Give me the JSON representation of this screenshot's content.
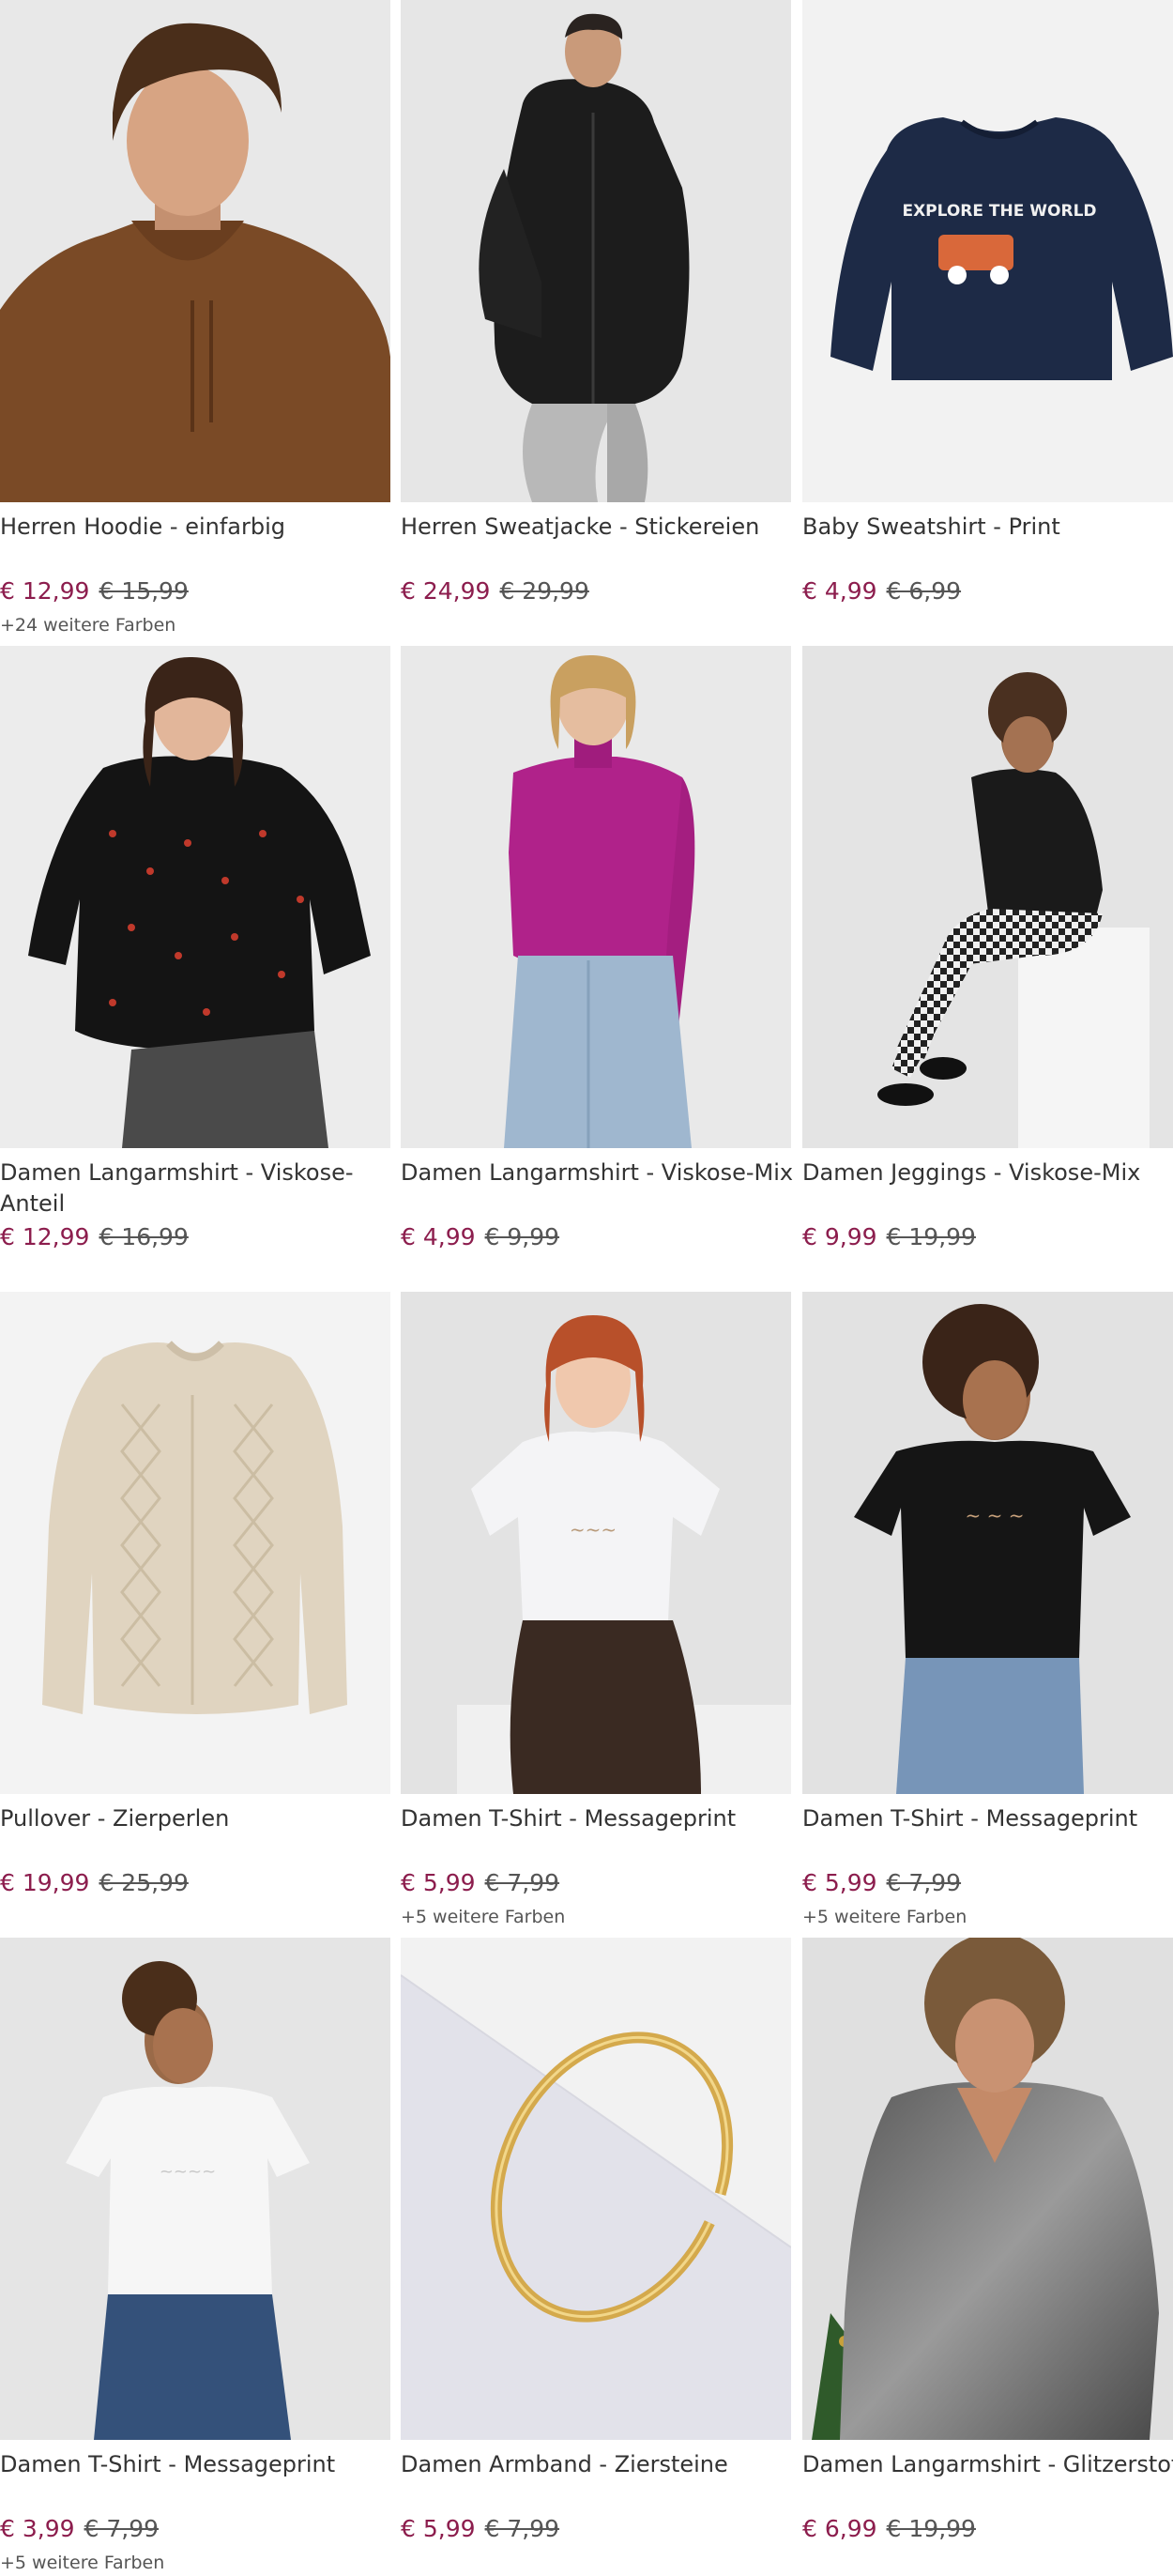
{
  "products": [
    {
      "title": "Herren Hoodie - einfarbig",
      "price": "€ 12,99",
      "old_price": "€ 15,99",
      "colors": "+24 weitere Farben"
    },
    {
      "title": "Herren Sweatjacke - Stickereien",
      "price": "€ 24,99",
      "old_price": "€ 29,99",
      "colors": ""
    },
    {
      "title": "Baby Sweatshirt - Print",
      "price": "€ 4,99",
      "old_price": "€ 6,99",
      "colors": "",
      "graphic_text": "EXPLORE THE WORLD"
    },
    {
      "title": "Damen Langarmshirt - Viskose-Anteil",
      "price": "€ 12,99",
      "old_price": "€ 16,99",
      "colors": ""
    },
    {
      "title": "Damen Langarmshirt - Viskose-Mix",
      "price": "€ 4,99",
      "old_price": "€ 9,99",
      "colors": ""
    },
    {
      "title": "Damen Jeggings - Viskose-Mix",
      "price": "€ 9,99",
      "old_price": "€ 19,99",
      "colors": ""
    },
    {
      "title": "Pullover - Zierperlen",
      "price": "€ 19,99",
      "old_price": "€ 25,99",
      "colors": ""
    },
    {
      "title": "Damen T-Shirt - Messageprint",
      "price": "€ 5,99",
      "old_price": "€ 7,99",
      "colors": "+5 weitere Farben"
    },
    {
      "title": "Damen T-Shirt - Messageprint",
      "price": "€ 5,99",
      "old_price": "€ 7,99",
      "colors": "+5 weitere Farben"
    },
    {
      "title": "Damen T-Shirt - Messageprint",
      "price": "€ 3,99",
      "old_price": "€ 7,99",
      "colors": "+5 weitere Farben"
    },
    {
      "title": "Damen Armband - Ziersteine",
      "price": "€ 5,99",
      "old_price": "€ 7,99",
      "colors": ""
    },
    {
      "title": "Damen Langarmshirt - Glitzerstoff",
      "price": "€ 6,99",
      "old_price": "€ 19,99",
      "colors": ""
    }
  ],
  "colors": {
    "sale_price": "#8c1d4d",
    "old_price": "#555555",
    "title": "#333333",
    "image_background": "#ededed"
  }
}
